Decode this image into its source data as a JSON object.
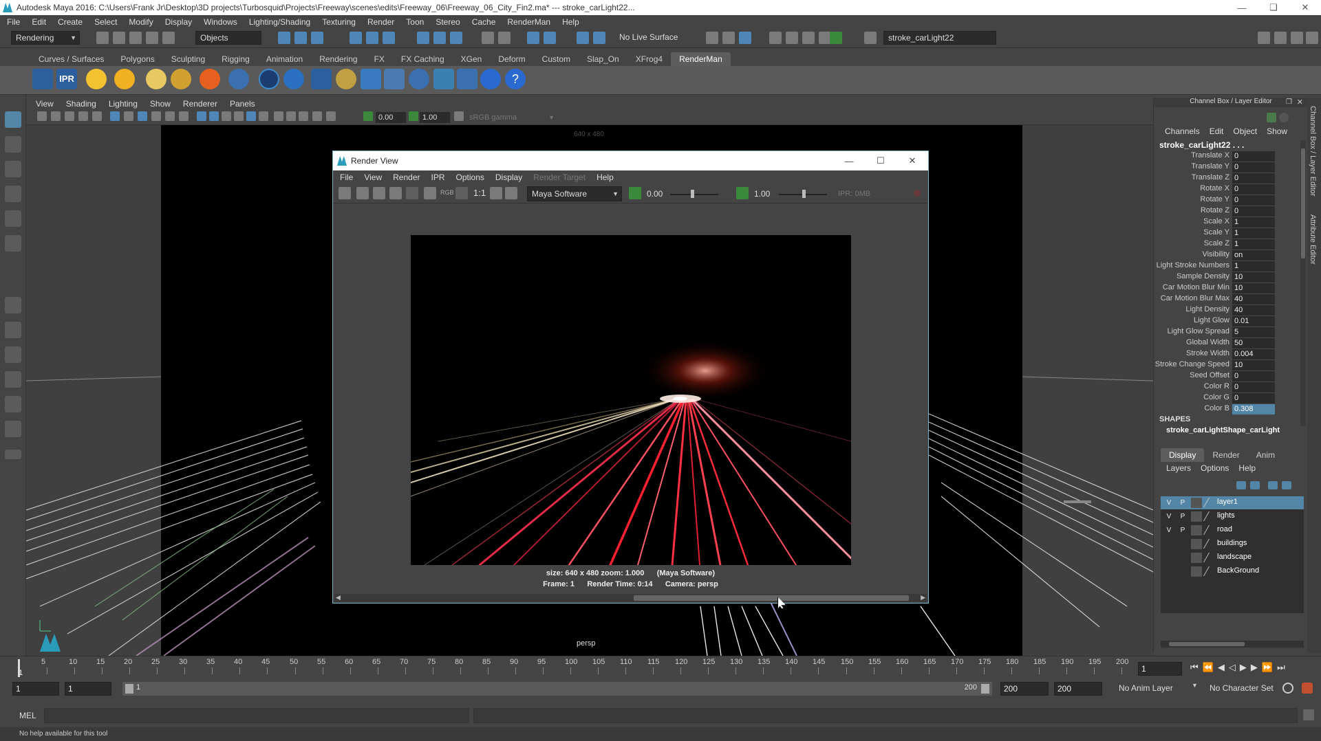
{
  "window": {
    "title": "Autodesk Maya 2016: C:\\Users\\Frank Jr\\Desktop\\3D projects\\Turbosquid\\Projects\\Freeway\\scenes\\edits\\Freeway_06\\Freeway_06_City_Fin2.ma*   ---   stroke_carLight22..."
  },
  "menubar": [
    "File",
    "Edit",
    "Create",
    "Select",
    "Modify",
    "Display",
    "Windows",
    "Lighting/Shading",
    "Texturing",
    "Render",
    "Toon",
    "Stereo",
    "Cache",
    "RenderMan",
    "Help"
  ],
  "statusline": {
    "menuset": "Rendering",
    "selection_mode": "Objects",
    "live_surface": "No Live Surface",
    "name_field": "stroke_carLight22"
  },
  "shelf_tabs": [
    "Curves / Surfaces",
    "Polygons",
    "Sculpting",
    "Rigging",
    "Animation",
    "Rendering",
    "FX",
    "FX Caching",
    "XGen",
    "Deform",
    "Custom",
    "Slap_On",
    "XFrog4",
    "RenderMan"
  ],
  "shelf_active": "RenderMan",
  "shelf_ipr_label": "IPR",
  "viewport": {
    "menu": [
      "View",
      "Shading",
      "Lighting",
      "Show",
      "Renderer",
      "Panels"
    ],
    "exposure": "0.00",
    "gamma": "1.00",
    "colorspace": "sRGB gamma",
    "resolution_gate": "640 x 480",
    "camera_label": "persp"
  },
  "render_view": {
    "title": "Render View",
    "menu": [
      "File",
      "View",
      "Render",
      "IPR",
      "Options",
      "Display",
      "Render Target",
      "Help"
    ],
    "renderer": "Maya Software",
    "exposure": "0.00",
    "gamma": "1.00",
    "ratio": "1:1",
    "rgb": "RGB",
    "ipr_mem": "IPR: 0MB",
    "info_line1": "size: 640 x 480 zoom: 1.000      (Maya Software)",
    "info_line2": "Frame: 1      Render Time: 0:14      Camera: persp"
  },
  "channel_box": {
    "header": "Channel Box / Layer Editor",
    "menu": [
      "Channels",
      "Edit",
      "Object",
      "Show"
    ],
    "object": "stroke_carLight22 . . .",
    "attributes": [
      {
        "name": "Translate X",
        "value": "0"
      },
      {
        "name": "Translate Y",
        "value": "0"
      },
      {
        "name": "Translate Z",
        "value": "0"
      },
      {
        "name": "Rotate X",
        "value": "0"
      },
      {
        "name": "Rotate Y",
        "value": "0"
      },
      {
        "name": "Rotate Z",
        "value": "0"
      },
      {
        "name": "Scale X",
        "value": "1"
      },
      {
        "name": "Scale Y",
        "value": "1"
      },
      {
        "name": "Scale Z",
        "value": "1"
      },
      {
        "name": "Visibility",
        "value": "on"
      },
      {
        "name": "Light Stroke Numbers",
        "value": "1"
      },
      {
        "name": "Sample Density",
        "value": "10"
      },
      {
        "name": "Car Motion Blur Min",
        "value": "10"
      },
      {
        "name": "Car Motion Blur Max",
        "value": "40"
      },
      {
        "name": "Light Density",
        "value": "40"
      },
      {
        "name": "Light Glow",
        "value": "0.01"
      },
      {
        "name": "Light Glow Spread",
        "value": "5"
      },
      {
        "name": "Global Width",
        "value": "50"
      },
      {
        "name": "Stroke Width",
        "value": "0.004"
      },
      {
        "name": "Stroke Change Speed",
        "value": "10"
      },
      {
        "name": "Seed Offset",
        "value": "0"
      },
      {
        "name": "Color R",
        "value": "0"
      },
      {
        "name": "Color G",
        "value": "0"
      },
      {
        "name": "Color B",
        "value": "0.308"
      }
    ],
    "shapes_label": "SHAPES",
    "shape_name": "stroke_carLightShape_carLight"
  },
  "side_tabs": [
    "Channel Box / Layer Editor",
    "Attribute Editor"
  ],
  "layer_editor": {
    "tabs": [
      "Display",
      "Render",
      "Anim"
    ],
    "menu": [
      "Layers",
      "Options",
      "Help"
    ],
    "layers": [
      {
        "name": "layer1",
        "v": "V",
        "p": "P",
        "selected": true
      },
      {
        "name": "lights",
        "v": "V",
        "p": "P",
        "selected": false
      },
      {
        "name": "road",
        "v": "V",
        "p": "P",
        "selected": false
      },
      {
        "name": "buildings",
        "v": "",
        "p": "",
        "selected": false
      },
      {
        "name": "landscape",
        "v": "",
        "p": "",
        "selected": false
      },
      {
        "name": "BackGround",
        "v": "",
        "p": "",
        "selected": false
      }
    ]
  },
  "timeline": {
    "ticks": [
      "5",
      "10",
      "15",
      "20",
      "25",
      "30",
      "35",
      "40",
      "45",
      "50",
      "55",
      "60",
      "65",
      "70",
      "75",
      "80",
      "85",
      "90",
      "95",
      "100",
      "105",
      "110",
      "115",
      "120",
      "125",
      "130",
      "135",
      "140",
      "145",
      "150",
      "155",
      "160",
      "165",
      "170",
      "175",
      "180",
      "185",
      "190",
      "195",
      "200"
    ],
    "start_tick": "1",
    "current_frame": "1"
  },
  "range": {
    "start": "1",
    "playback_start": "1",
    "range_start_label": "1",
    "range_end_label": "200",
    "playback_end": "200",
    "end": "200",
    "anim_layer": "No Anim Layer",
    "character_set": "No Character Set"
  },
  "cmdline": {
    "label": "MEL"
  },
  "help_line": "No help available for this tool",
  "colors": {
    "accent": "#5285a6",
    "maya_teal": "#2a9bb8",
    "active_green": "#3b8a3b"
  }
}
